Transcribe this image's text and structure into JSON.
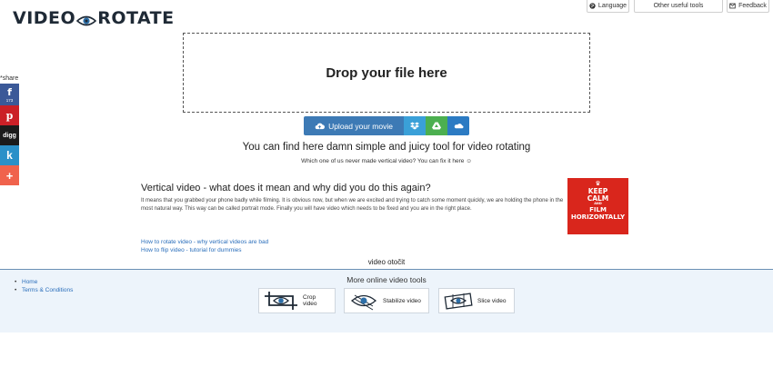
{
  "logo": {
    "left": "VIDEO",
    "right": "ROTATE"
  },
  "top_bar": {
    "language": "Language",
    "other_tools": "Other useful tools",
    "feedback": "Feedback"
  },
  "share": {
    "label": "share",
    "facebook_count": "173"
  },
  "dropzone": {
    "label": "Drop your file here"
  },
  "upload": {
    "label": "Upload your movie"
  },
  "intro": {
    "headline": "You can find here damn simple and juicy tool for video rotating",
    "subline": "Which one of us never made vertical video? You can fix it here ☺"
  },
  "article": {
    "title": "Vertical video - what does it mean and why did you do this again?",
    "text": "It means that you grabbed your phone badly while filming. It is obvious now, but when we are excited and trying to catch some moment quickly, we are holding the phone in the most natural way. This way can be called portrait mode. Finally you will have video which needs to be fixed and you are in the right place.",
    "poster": {
      "line1": "KEEP",
      "line2": "CALM",
      "line3": "AND",
      "line4": "FILM",
      "line5": "HORIZONTALLY"
    }
  },
  "links": [
    {
      "label": "How to rotate video - why vertical videos are bad"
    },
    {
      "label": "How to flip video - tutorial for dummies"
    }
  ],
  "footer": {
    "caption": "video otočit",
    "nav": [
      {
        "label": "Home"
      },
      {
        "label": "Terms & Conditions"
      }
    ],
    "more_title": "More online video tools",
    "tools": [
      {
        "label": "Crop video"
      },
      {
        "label": "Stabilize video"
      },
      {
        "label": "Slice video"
      }
    ]
  },
  "colors": {
    "upload": "#3d7ab5",
    "dropbox": "#3aa0d8",
    "gdrive": "#4caf50",
    "onedrive": "#2c7bc3",
    "facebook": "#3b5998",
    "pinterest": "#cb2027",
    "digg": "#1b1b1b",
    "vk": "#2b90c8",
    "more": "#f0624c",
    "poster": "#d9261c",
    "footer_bg": "#edf4fb",
    "link": "#2a6ebb"
  }
}
